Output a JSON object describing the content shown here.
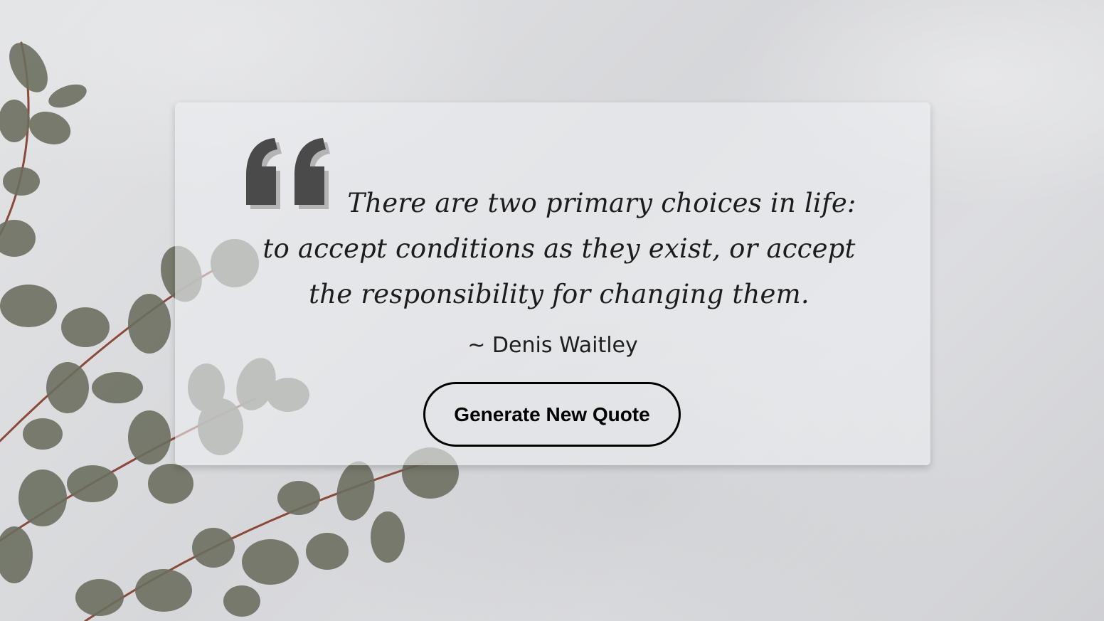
{
  "quote": {
    "text": "There are two primary choices in life: to accept conditions as they exist, or accept the responsibility for changing them.",
    "author": "~ Denis Waitley",
    "mark_icon": "quote-left-icon",
    "mark_color": "#4a4a4a"
  },
  "actions": {
    "generate_label": "Generate New Quote"
  },
  "theme": {
    "card_bg": "#eceef0",
    "leaf_color": "#6b6f5f",
    "stem_color": "#8a4a3a"
  }
}
